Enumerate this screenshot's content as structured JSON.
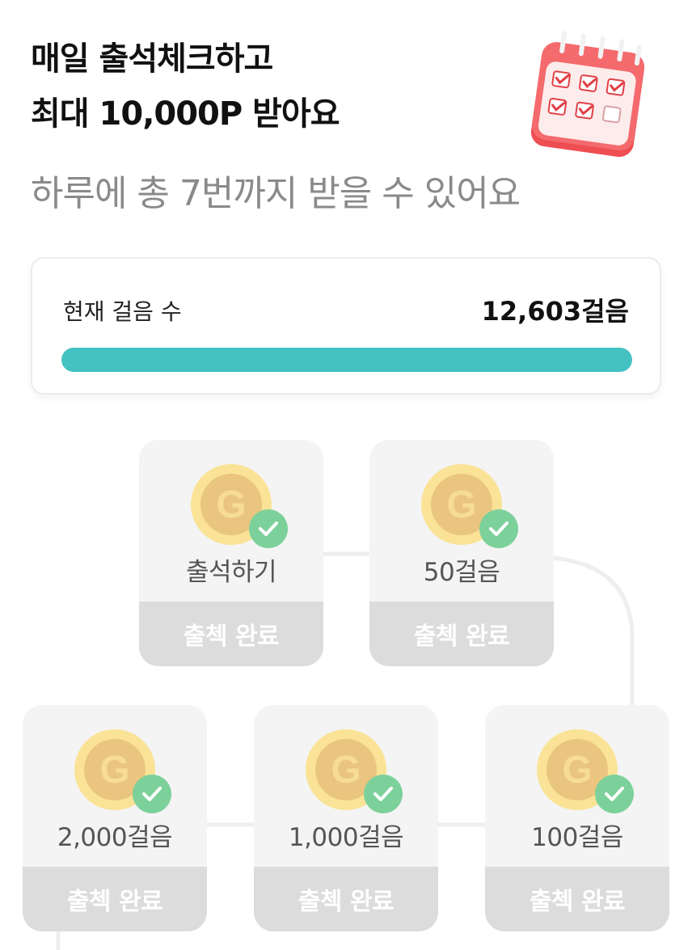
{
  "header": {
    "title_line1": "매일 출석체크하고",
    "title_line2": "최대 10,000P 받아요",
    "subtitle": "하루에 총 7번까지 받을 수 있어요",
    "illustration_icon": "calendar-checklist-icon"
  },
  "steps_card": {
    "label": "현재 걸음 수",
    "value": "12,603걸음",
    "progress_fraction": 1.0,
    "progress_color": "#44c2c2"
  },
  "rewards": [
    {
      "label": "출석하기",
      "button_label": "출첵 완료",
      "status": "completed",
      "icon": "coin-g-icon"
    },
    {
      "label": "50걸음",
      "button_label": "출첵 완료",
      "status": "completed",
      "icon": "coin-g-icon"
    },
    {
      "label": "100걸음",
      "button_label": "출첵 완료",
      "status": "completed",
      "icon": "coin-g-icon"
    },
    {
      "label": "1,000걸음",
      "button_label": "출첵 완료",
      "status": "completed",
      "icon": "coin-g-icon"
    },
    {
      "label": "2,000걸음",
      "button_label": "출첵 완료",
      "status": "completed",
      "icon": "coin-g-icon"
    }
  ],
  "colors": {
    "check_badge": "#7cd19a",
    "coin_outer": "#f9e090",
    "coin_inner": "#e8c27a",
    "calendar_red": "#f0585c"
  }
}
